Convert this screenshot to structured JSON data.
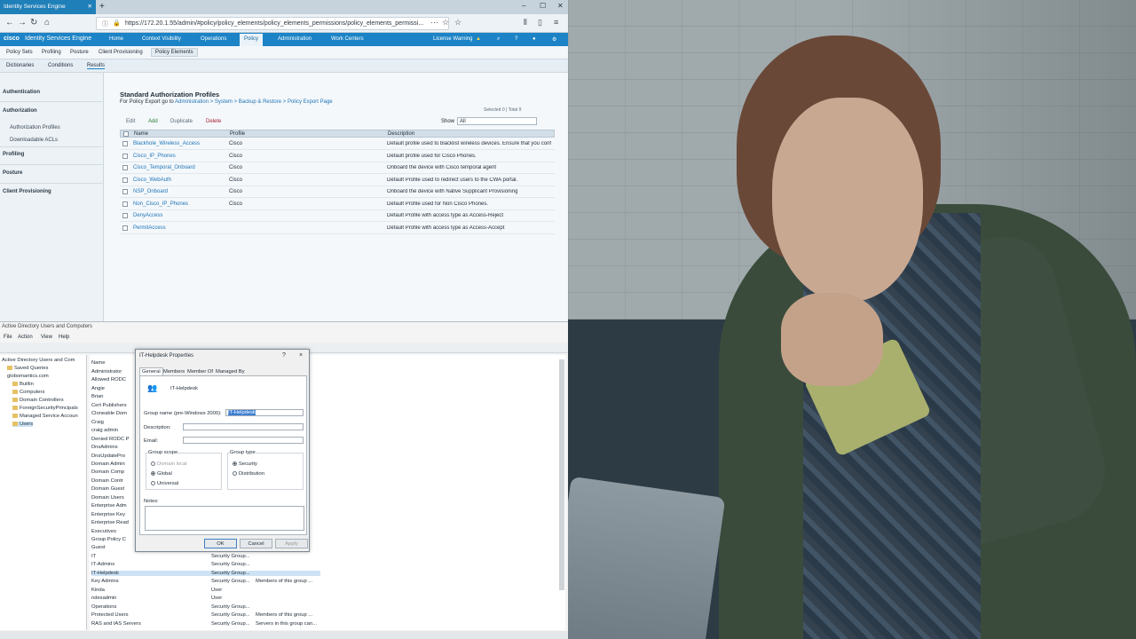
{
  "browser": {
    "tab_title": "Identity Services Engine",
    "url": "https://172.20.1.55/admin/#policy/policy_elements/policy_elements_permissions/policy_elements_permissi..."
  },
  "ise": {
    "logo": "cisco",
    "product": "Identity Services Engine",
    "nav": [
      "Home",
      "Context Visibility",
      "Operations",
      "Policy",
      "Administration",
      "Work Centers"
    ],
    "license": "License Warning",
    "subnav": [
      "Policy Sets",
      "Profiling",
      "Posture",
      "Client Provisioning",
      "Policy Elements"
    ],
    "subnav2": [
      "Dictionaries",
      "Conditions",
      "Results"
    ],
    "sidebar": {
      "authentication": "Authentication",
      "authorization": "Authorization",
      "auth_profiles": "Authorization Profiles",
      "dacls": "Downloadable ACLs",
      "profiling": "Profiling",
      "posture": "Posture",
      "client_prov": "Client Provisioning"
    },
    "page_title": "Standard Authorization Profiles",
    "export_prefix": "For Policy Export go to",
    "export_link": "Administration > System > Backup & Restore > Policy Export Page",
    "selected": "Selected 0 | Total 9",
    "toolbar": {
      "edit": "Edit",
      "add": "Add",
      "duplicate": "Duplicate",
      "delete": "Delete",
      "show": "Show",
      "show_value": "All"
    },
    "columns": [
      "Name",
      "Profile",
      "Description"
    ],
    "rows": [
      {
        "name": "Blackhole_Wireless_Access",
        "profile": "Cisco",
        "desc": "Default profile used to blacklist wireless devices. Ensure that you conf"
      },
      {
        "name": "Cisco_IP_Phones",
        "profile": "Cisco",
        "desc": "Default profile used for Cisco Phones."
      },
      {
        "name": "Cisco_Temporal_Onboard",
        "profile": "Cisco",
        "desc": "Onboard the device with Cisco temporal agent"
      },
      {
        "name": "Cisco_WebAuth",
        "profile": "Cisco",
        "desc": "Default Profile used to redirect users to the CWA portal."
      },
      {
        "name": "NSP_Onboard",
        "profile": "Cisco",
        "desc": "Onboard the device with Native Supplicant Provisioning"
      },
      {
        "name": "Non_Cisco_IP_Phones",
        "profile": "Cisco",
        "desc": "Default Profile used for Non Cisco Phones."
      },
      {
        "name": "DenyAccess",
        "profile": "",
        "desc": "Default Profile with access type as Access-Reject"
      },
      {
        "name": "PermitAccess",
        "profile": "",
        "desc": "Default Profile with access type as Access-Accept"
      }
    ]
  },
  "aduc": {
    "title": "Active Directory Users and Computers",
    "menu": [
      "File",
      "Action",
      "View",
      "Help"
    ],
    "tree": [
      "Active Directory Users and Com",
      "Saved Queries",
      "globomantics.com",
      "Builtin",
      "Computers",
      "Domain Controllers",
      "ForeignSecurityPrincipals",
      "Managed Service Accoun",
      "Users"
    ],
    "list_header": "Name",
    "items": [
      "Administrator",
      "Allowed RODC",
      "Angie",
      "Brian",
      "Cert Publishers",
      "Cloneable Dom",
      "Craig",
      "craig admin",
      "Denied RODC P",
      "DnsAdmins",
      "DnsUpdatePro",
      "Domain Admin",
      "Domain Comp",
      "Domain Contr",
      "Domain Guest",
      "Domain Users",
      "Enterprise Adm",
      "Enterprise Key",
      "Enterprise Read",
      "Executives",
      "Group Policy C",
      "Guest",
      "IT",
      "IT-Admins",
      "IT-Helpdesk",
      "Key Admins",
      "Kinda",
      "ndesadmin",
      "Operations",
      "Protected Users",
      "RAS and IAS Servers"
    ],
    "types": [
      "Security Group...",
      "Security Group...",
      "Security Group...",
      "Security Group...",
      "User",
      "User",
      "Security Group...",
      "Security Group...",
      "Security Group..."
    ],
    "descs": [
      "",
      "",
      "",
      "Members of this group ...",
      "",
      "",
      "",
      "Members of this group ...",
      "Servers in this group can..."
    ]
  },
  "dialog": {
    "title": "IT-Helpdesk Properties",
    "help": "?",
    "close": "×",
    "tabs": [
      "General",
      "Members",
      "Member Of",
      "Managed By"
    ],
    "group_name": "IT-Helpdesk",
    "pre2000_label": "Group name (pre-Windows 2000):",
    "pre2000_value": "IT-Helpdesk",
    "description_label": "Description:",
    "email_label": "Email:",
    "scope_label": "Group scope",
    "scope_options": [
      "Domain local",
      "Global",
      "Universal"
    ],
    "type_label": "Group type",
    "type_options": [
      "Security",
      "Distribution"
    ],
    "notes_label": "Notes:",
    "ok": "OK",
    "cancel": "Cancel",
    "apply": "Apply"
  }
}
